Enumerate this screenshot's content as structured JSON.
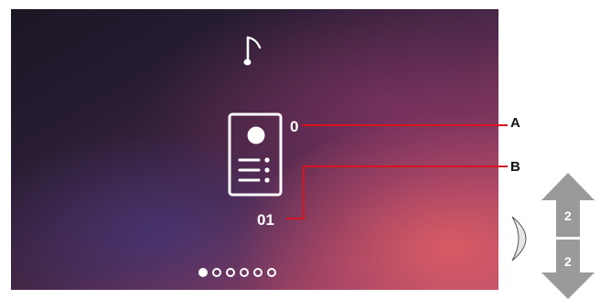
{
  "screen": {
    "icons": {
      "music": "music-note-icon",
      "device": "entrance-panel-icon"
    },
    "value_a": "0",
    "value_b": "01",
    "page_indicator": {
      "total": 6,
      "active_index": 0
    }
  },
  "callouts": {
    "a_label": "A",
    "b_label": "B",
    "line_color": "#d7141e"
  },
  "side_controls": {
    "button_icon": "side-rocker-button-icon",
    "up_step": "2",
    "down_step": "2",
    "arrow_color": "#9a9a9a"
  }
}
